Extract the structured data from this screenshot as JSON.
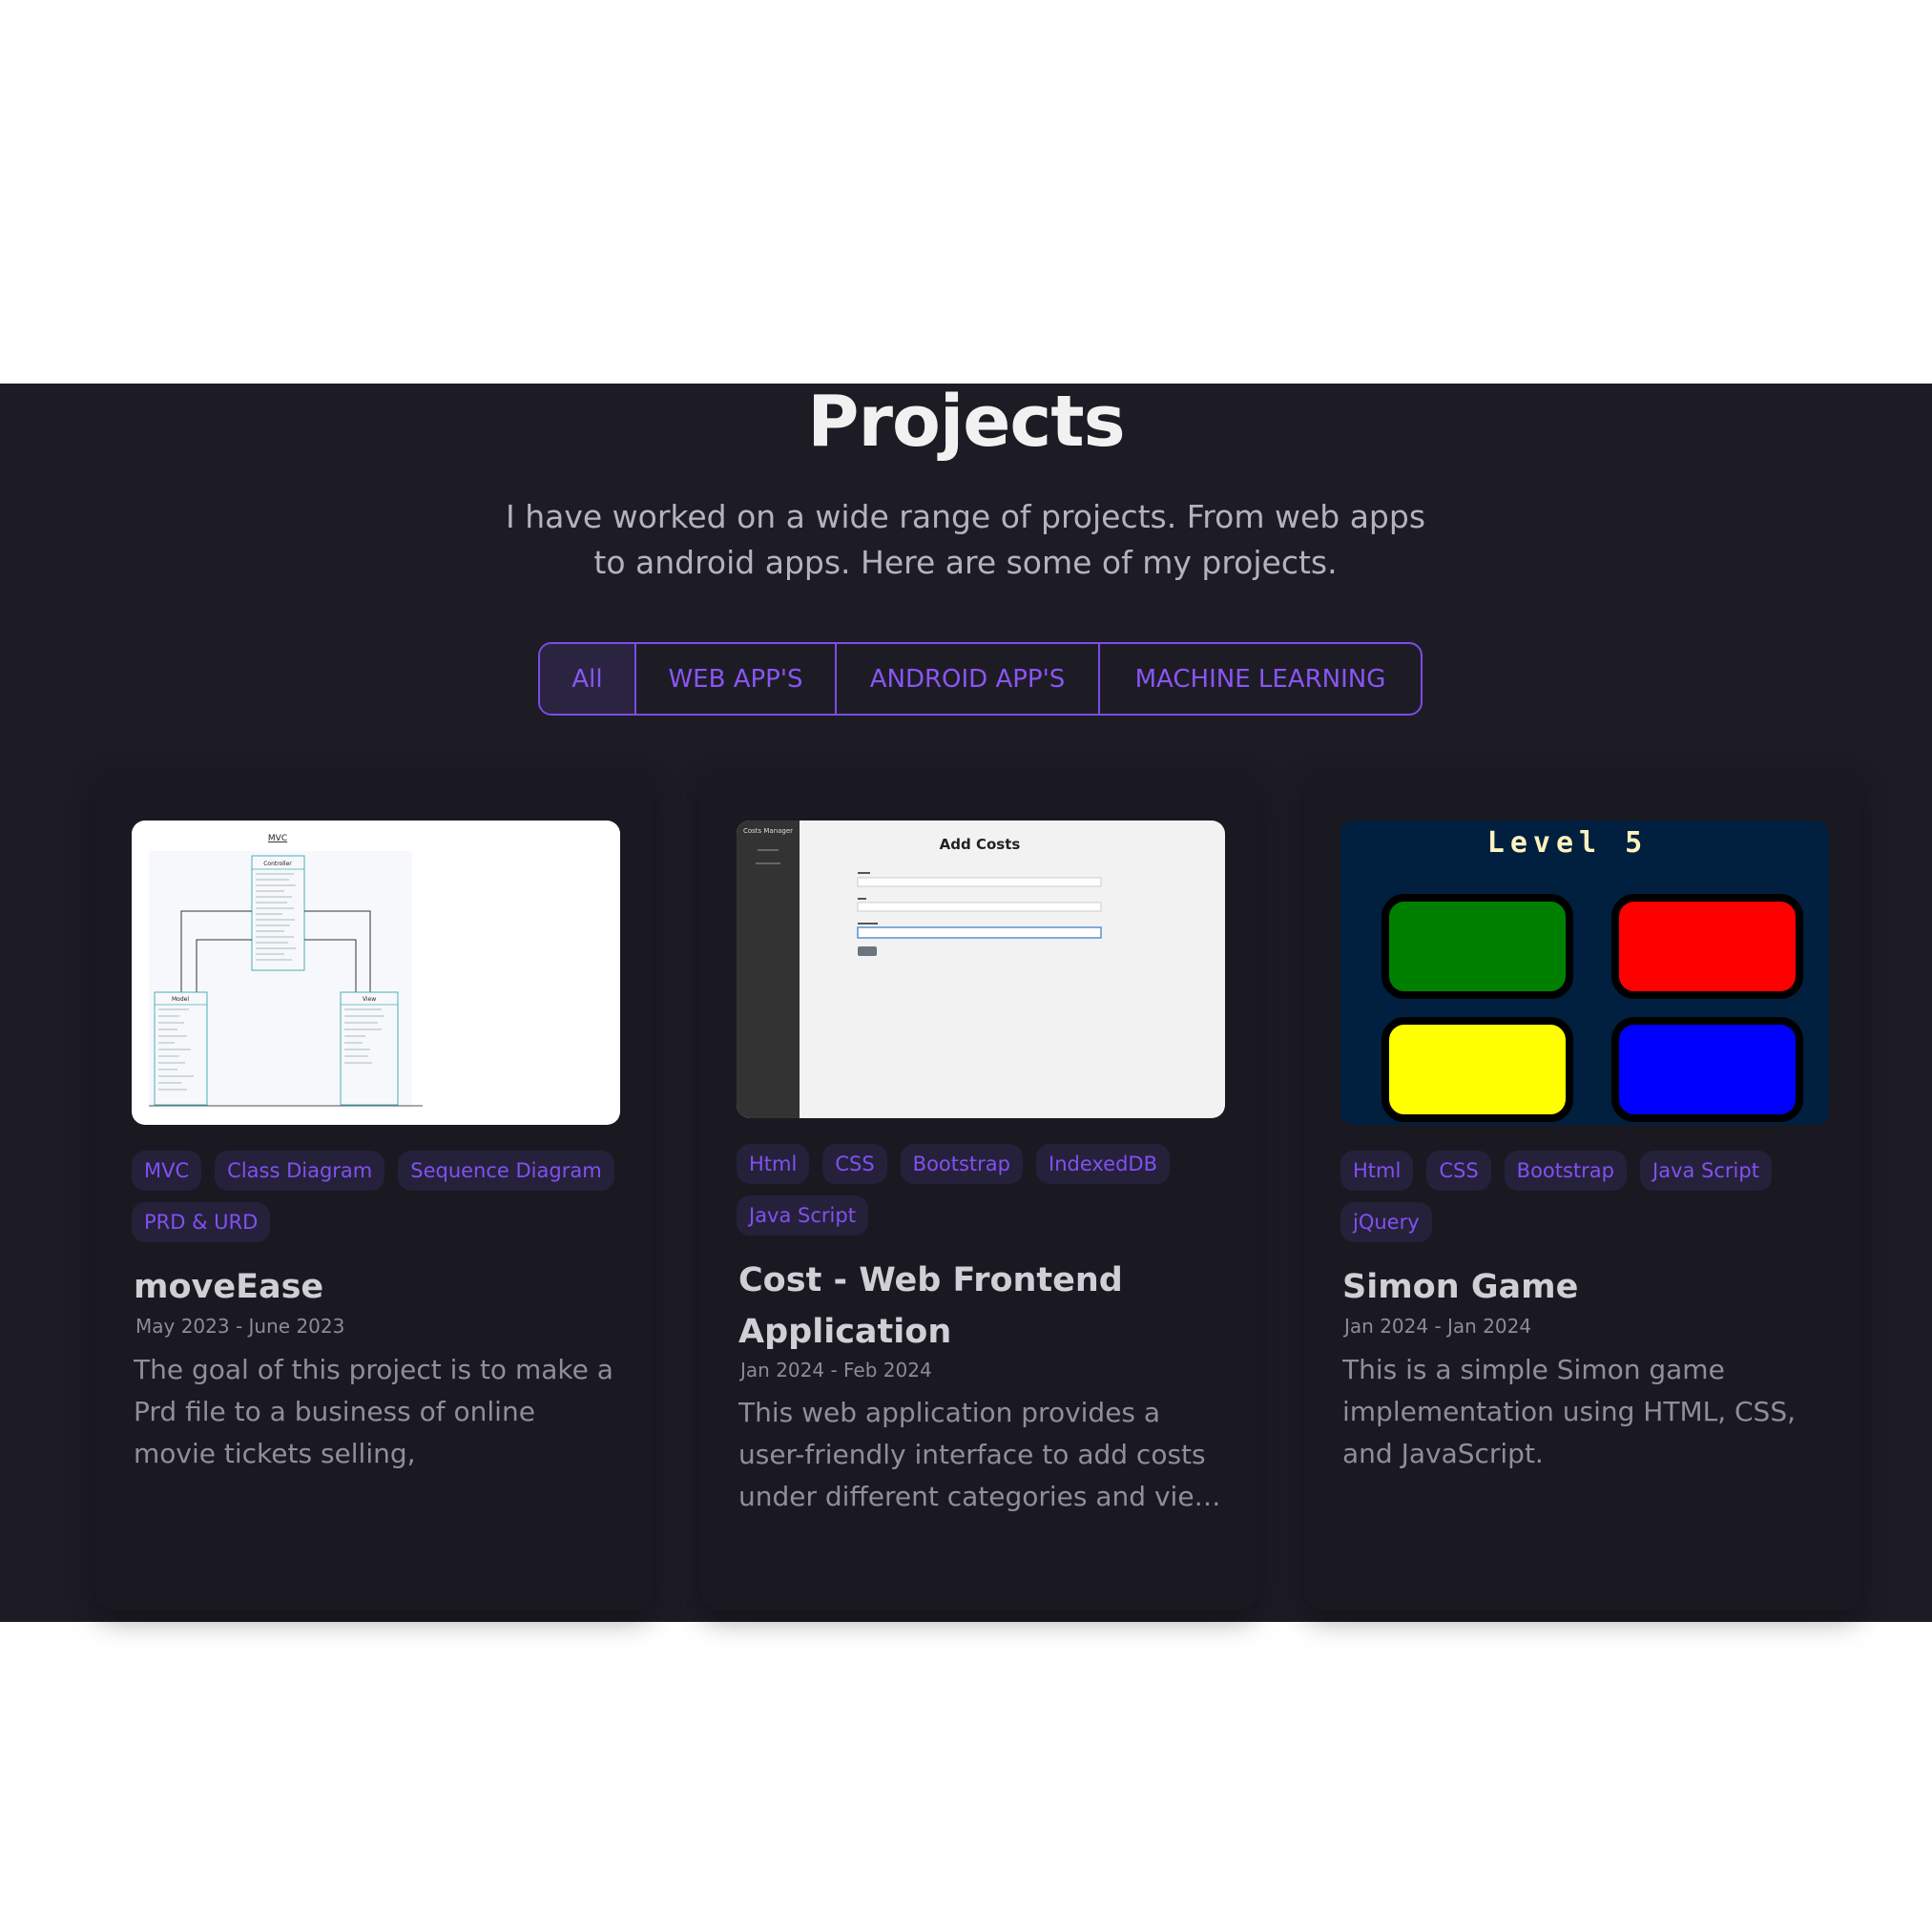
{
  "header": {
    "title": "Projects",
    "subtitle": "I have worked on a wide range of projects. From web apps to android apps. Here are some of my projects."
  },
  "filters": [
    "All",
    "WEB APP'S",
    "ANDROID APP'S",
    "MACHINE LEARNING"
  ],
  "colors": {
    "background": "#1d1c25",
    "card": "#1a1921",
    "accent": "#8250f2",
    "tag_bg": "#25213a"
  },
  "projects": [
    {
      "title": "moveEase",
      "date": "May 2023 - June 2023",
      "description": "The goal of this project is to make a Prd file to a business of online movie tickets selling,",
      "tags": [
        "MVC",
        "Class Diagram",
        "Sequence Diagram",
        "PRD & URD"
      ],
      "thumb": {
        "diagram_title": "MVC",
        "controller": "Controller",
        "model": "Model",
        "view": "View"
      }
    },
    {
      "title": "Cost - Web Frontend Application",
      "date": "Jan 2024 - Feb 2024",
      "description": "This web application provides a user-friendly interface to add costs under different categories and view reports.",
      "tags": [
        "Html",
        "CSS",
        "Bootstrap",
        "IndexedDB",
        "Java Script"
      ],
      "thumb": {
        "app_name": "Costs Manager",
        "heading": "Add Costs"
      }
    },
    {
      "title": "Simon Game",
      "date": "Jan 2024 - Jan 2024",
      "description": "This is a simple Simon game implementation using HTML, CSS, and JavaScript.",
      "tags": [
        "Html",
        "CSS",
        "Bootstrap",
        "Java Script",
        "jQuery"
      ],
      "thumb": {
        "level_text": "Level 5",
        "pad_colors": [
          "#008000",
          "#ff0000",
          "#ffff00",
          "#0000ff"
        ]
      }
    }
  ]
}
